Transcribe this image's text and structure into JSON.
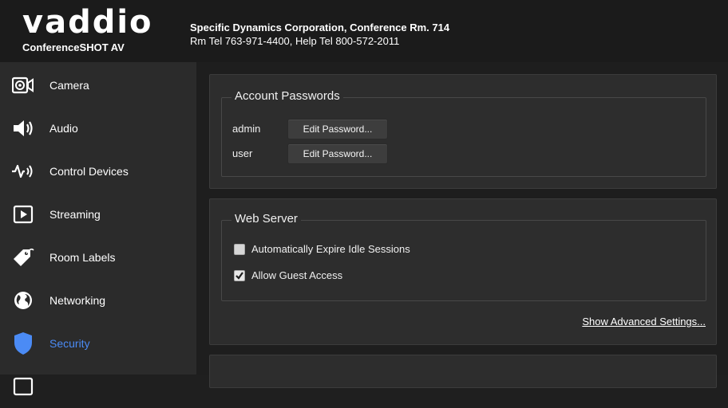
{
  "header": {
    "logo": "vaddio",
    "product": "ConferenceSHOT AV",
    "room_line1": "Specific Dynamics Corporation, Conference Rm. 714",
    "room_line2": "Rm Tel 763-971-4400, Help Tel 800-572-2011"
  },
  "sidebar": {
    "items": [
      {
        "label": "Camera",
        "icon": "camera-icon"
      },
      {
        "label": "Audio",
        "icon": "speaker-icon"
      },
      {
        "label": "Control Devices",
        "icon": "control-devices-icon"
      },
      {
        "label": "Streaming",
        "icon": "play-icon"
      },
      {
        "label": "Room Labels",
        "icon": "tag-icon"
      },
      {
        "label": "Networking",
        "icon": "globe-icon"
      },
      {
        "label": "Security",
        "icon": "shield-icon",
        "active": true
      }
    ]
  },
  "colors": {
    "accent": "#4b8bf5",
    "sidebar_bg": "#2b2b2b",
    "panel_bg": "#2d2d2d",
    "header_bg": "#1b1b1b"
  },
  "account_passwords": {
    "title": "Account Passwords",
    "rows": [
      {
        "label": "admin",
        "button": "Edit Password..."
      },
      {
        "label": "user",
        "button": "Edit Password..."
      }
    ]
  },
  "web_server": {
    "title": "Web Server",
    "options": [
      {
        "label": "Automatically Expire Idle Sessions",
        "checked": false
      },
      {
        "label": "Allow Guest Access",
        "checked": true
      }
    ],
    "advanced_link": "Show Advanced Settings..."
  }
}
